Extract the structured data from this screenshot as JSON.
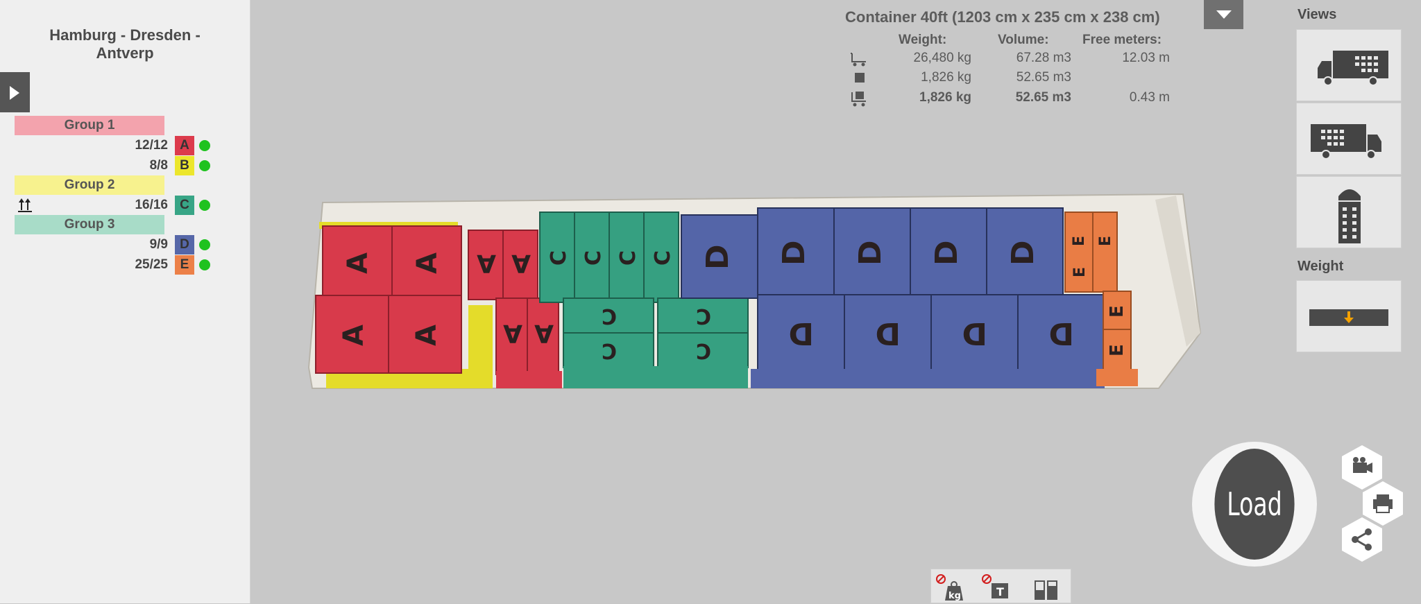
{
  "route": {
    "title_line1": "Hamburg - Dresden -",
    "title_line2": "Antverp"
  },
  "groups": [
    {
      "label": "Group 1",
      "color": "#f3a3ad"
    },
    {
      "label": "Group 2",
      "color": "#f7f28e"
    },
    {
      "label": "Group 3",
      "color": "#a8dcc8"
    }
  ],
  "items": [
    {
      "count": "12/12",
      "letter": "A",
      "color": "#dc3b4c",
      "status": "ok"
    },
    {
      "count": "8/8",
      "letter": "B",
      "color": "#ece62c",
      "status": "ok"
    },
    {
      "count": "16/16",
      "letter": "C",
      "color": "#38a586",
      "status": "ok",
      "stackable_icon": "stack-arrows-icon"
    },
    {
      "count": "9/9",
      "letter": "D",
      "color": "#5667a8",
      "status": "ok"
    },
    {
      "count": "25/25",
      "letter": "E",
      "color": "#ec8048",
      "status": "ok"
    }
  ],
  "container": {
    "title": "Container 40ft (1203 cm x 235 cm x 238 cm)",
    "headers": {
      "weight": "Weight:",
      "volume": "Volume:",
      "free_meters": "Free meters:"
    },
    "rows": [
      {
        "icon": "trolley-icon",
        "weight": "26,480 kg",
        "volume": "67.28 m3",
        "free_meters": "12.03 m",
        "bold": false
      },
      {
        "icon": "box-icon",
        "weight": "1,826 kg",
        "volume": "52.65 m3",
        "free_meters": "",
        "bold": false
      },
      {
        "icon": "loaded-trolley-icon",
        "weight": "1,826 kg",
        "volume": "52.65 m3",
        "free_meters": "0.43 m",
        "bold": true
      }
    ]
  },
  "views": {
    "label": "Views",
    "options": [
      "truck-side-left-icon",
      "truck-side-right-icon",
      "truck-top-icon"
    ]
  },
  "weight": {
    "label": "Weight",
    "indicator_icon": "arrow-down-icon"
  },
  "actions": {
    "load_label": "Load"
  },
  "side_buttons": [
    "camera-icon",
    "print-icon",
    "share-icon"
  ],
  "toolbar": [
    "weight-off-icon",
    "text-off-icon",
    "layout-compare-icon"
  ]
}
